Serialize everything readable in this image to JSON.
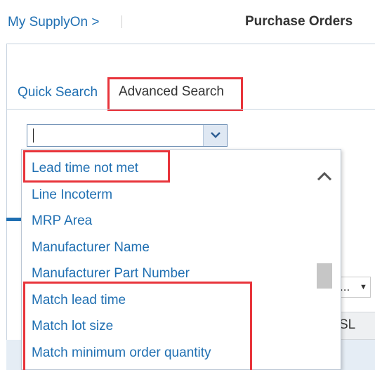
{
  "header": {
    "breadcrumb": "My SupplyOn >",
    "title": "Purchase Orders"
  },
  "tabs": {
    "quick": "Quick Search",
    "advanced": "Advanced Search"
  },
  "search": {
    "input_value": ""
  },
  "dropdown": {
    "items": [
      "Lead time not met",
      "Line Incoterm",
      "MRP Area",
      "Manufacturer Name",
      "Manufacturer Part Number",
      "Match lead time",
      "Match lot size",
      "Match minimum order quantity"
    ]
  },
  "toolbar": {
    "select_label": "..."
  },
  "table": {
    "column_label": "D SL"
  },
  "colors": {
    "link": "#1f6fb2",
    "highlight": "#e8343b"
  }
}
